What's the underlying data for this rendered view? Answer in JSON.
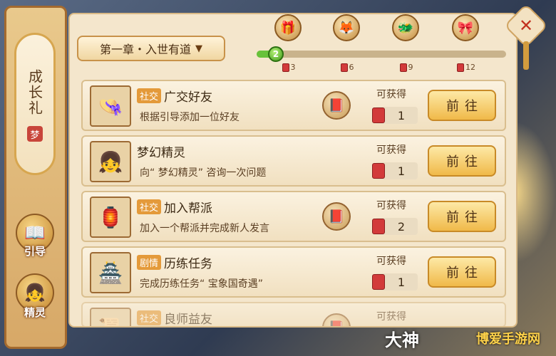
{
  "sidebar": {
    "growth_tab": "成长礼",
    "growth_seal": "梦",
    "guide_label": "引导",
    "sprite_label": "精灵"
  },
  "chapter": {
    "label": "第一章・入世有道"
  },
  "progress": {
    "current": "2",
    "fraction": 0.07,
    "milestones": [
      {
        "req": "3",
        "icon": "treasure-chest-icon"
      },
      {
        "req": "6",
        "icon": "fox-mask-icon"
      },
      {
        "req": "9",
        "icon": "dragon-icon"
      },
      {
        "req": "12",
        "icon": "gift-box-icon"
      }
    ]
  },
  "tasks": [
    {
      "tag": "社交",
      "title": "广交好友",
      "desc": "根据引导添加一位好友",
      "reward_label": "可获得",
      "count": "1",
      "go": "前往",
      "has_guide": true,
      "icon": "straw-hat-icon"
    },
    {
      "tag": "",
      "title": "梦幻精灵",
      "desc": "向“ 梦幻精灵” 咨询一次问题",
      "reward_label": "可获得",
      "count": "1",
      "go": "前往",
      "has_guide": false,
      "icon": "sprite-girl-icon"
    },
    {
      "tag": "社交",
      "title": "加入帮派",
      "desc": "加入一个帮派并完成新人发言",
      "reward_label": "可获得",
      "count": "2",
      "go": "前往",
      "has_guide": true,
      "icon": "banner-scroll-icon"
    },
    {
      "tag": "剧情",
      "title": "历练任务",
      "desc": "完成历练任务“ 宝象国奇遇”",
      "reward_label": "可获得",
      "count": "1",
      "go": "前往",
      "has_guide": false,
      "icon": "pagoda-icon"
    },
    {
      "tag": "社交",
      "title": "良师益友",
      "desc": "",
      "reward_label": "可获得",
      "count": "",
      "go": "",
      "has_guide": true,
      "icon": "scroll-icon"
    }
  ],
  "watermark": {
    "left": "大神",
    "right": "博爱手游网"
  }
}
